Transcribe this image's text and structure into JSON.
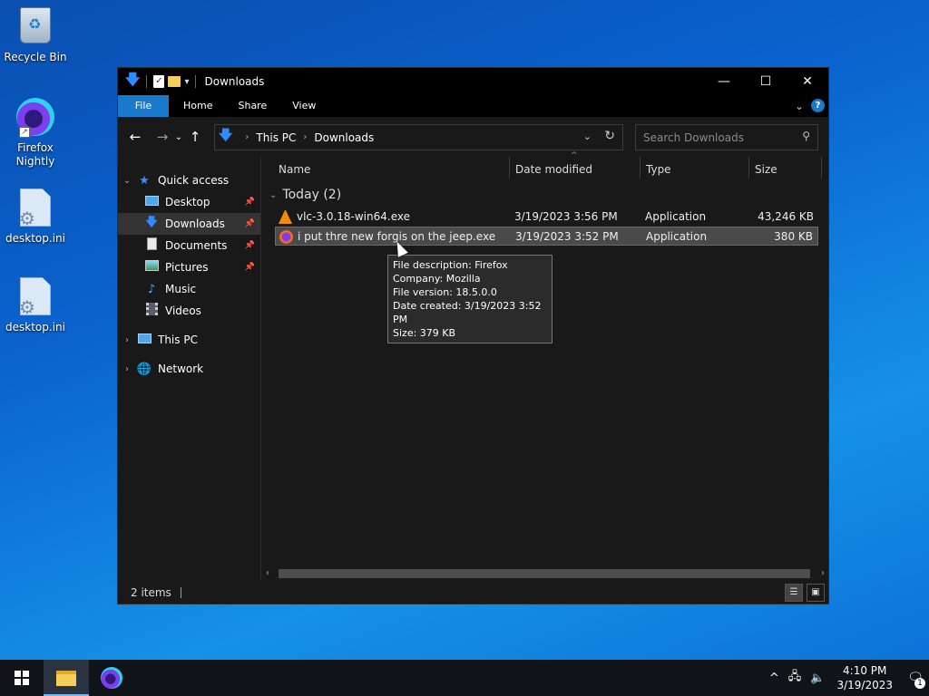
{
  "desktop": {
    "icons": [
      {
        "label": "Recycle Bin",
        "icon": "recycle-bin-icon"
      },
      {
        "label": "Firefox Nightly",
        "icon": "firefox-nightly-icon"
      },
      {
        "label": "desktop.ini",
        "icon": "settings-file-icon"
      },
      {
        "label": "desktop.ini",
        "icon": "settings-file-icon"
      }
    ]
  },
  "window": {
    "title": "Downloads",
    "controls": {
      "minimize": "—",
      "maximize": "☐",
      "close": "✕"
    },
    "ribbon": {
      "tabs": [
        "File",
        "Home",
        "Share",
        "View"
      ],
      "help": "?"
    },
    "address": {
      "crumbs": [
        "This PC",
        "Downloads"
      ]
    },
    "search": {
      "placeholder": "Search Downloads"
    },
    "nav_pane": {
      "quick_access": "Quick access",
      "items": [
        {
          "label": "Desktop",
          "pinned": true
        },
        {
          "label": "Downloads",
          "pinned": true,
          "selected": true
        },
        {
          "label": "Documents",
          "pinned": true
        },
        {
          "label": "Pictures",
          "pinned": true
        },
        {
          "label": "Music",
          "pinned": false
        },
        {
          "label": "Videos",
          "pinned": false
        }
      ],
      "this_pc": "This PC",
      "network": "Network"
    },
    "columns": {
      "name": "Name",
      "date": "Date modified",
      "type": "Type",
      "size": "Size"
    },
    "group": {
      "label": "Today (2)"
    },
    "files": [
      {
        "name": "vlc-3.0.18-win64.exe",
        "date": "3/19/2023 3:56 PM",
        "type": "Application",
        "size": "43,246 KB",
        "icon": "vlc-icon"
      },
      {
        "name": "i put thre new forgis on the jeep.exe",
        "date": "3/19/2023 3:52 PM",
        "type": "Application",
        "size": "380 KB",
        "icon": "firefox-file-icon"
      }
    ],
    "tooltip": {
      "lines": [
        "File description: Firefox",
        "Company: Mozilla",
        "File version: 18.5.0.0",
        "Date created: 3/19/2023 3:52 PM",
        "Size: 379 KB"
      ]
    },
    "status": {
      "items": "2 items"
    }
  },
  "taskbar": {
    "time": "4:10 PM",
    "date": "3/19/2023",
    "notification_count": "1"
  },
  "colors": {
    "accent": "#1979ca",
    "window_bg": "#191919",
    "selection": "#4a4a4a"
  }
}
